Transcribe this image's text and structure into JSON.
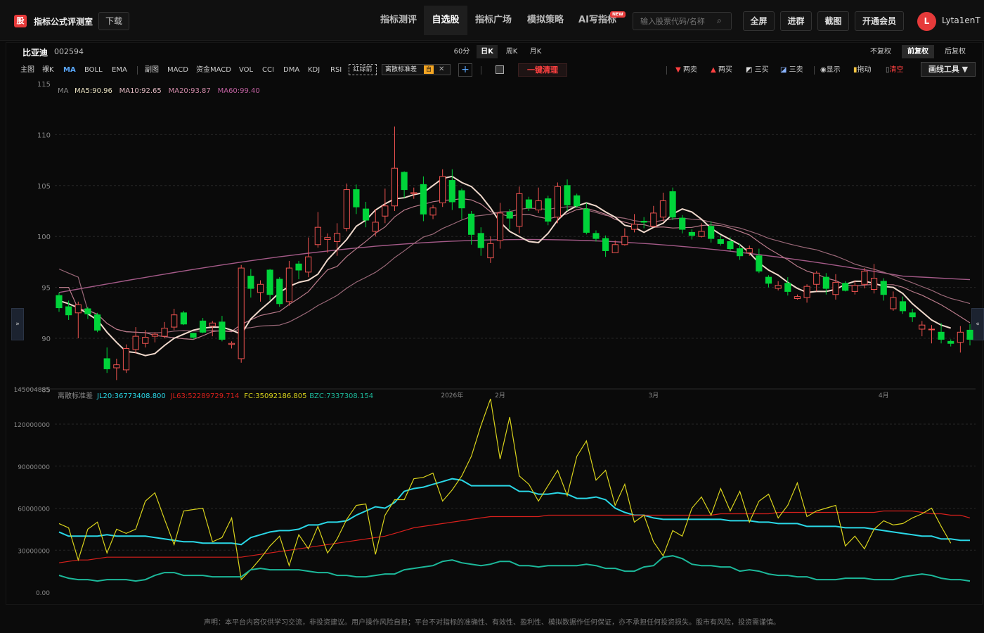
{
  "header": {
    "logo_char": "股",
    "app_name": "指标公式评测室",
    "download": "下载",
    "nav": [
      "指标测评",
      "自选股",
      "指标广场",
      "模拟策略",
      "AI写指标"
    ],
    "nav_active": 1,
    "new_badge": "NEW",
    "search_placeholder": "输入股票代码/名称",
    "buttons": [
      "全屏",
      "进群",
      "截图",
      "开通会员"
    ],
    "avatar_letter": "L",
    "username": "Lyta1enT"
  },
  "stock": {
    "name": "比亚迪",
    "code": "002594"
  },
  "periods": [
    "60分",
    "日K",
    "周K",
    "月K"
  ],
  "period_active": 1,
  "adjust": [
    "不复权",
    "前复权",
    "后复权"
  ],
  "adjust_active": 1,
  "indicator_bar": {
    "main": [
      "主图",
      "裸K",
      "MA",
      "BOLL",
      "EMA"
    ],
    "main_active": 2,
    "sub": [
      "副图",
      "MACD",
      "资金MACD",
      "VOL",
      "CCI",
      "DMA",
      "KDJ",
      "RSI"
    ],
    "highlight": "红绿箭",
    "chip": "离散标准差",
    "chip_tag": "自",
    "clear": "一键清理"
  },
  "tools": {
    "sell2": "两卖",
    "buy2": "两买",
    "buy3": "三买",
    "sell3": "三卖",
    "show": "显示",
    "drag": "拖动",
    "clear": "清空",
    "draw": "画线工具 ▼"
  },
  "colors": {
    "up": "#ef5350",
    "down": "#00d43a",
    "ma5": "#f0d9cc",
    "ma10": "#b87a8a",
    "ma20": "#9a6878",
    "ma60": "#a45a88",
    "jl20": "#2ad7e6",
    "jl63": "#d8201c",
    "fc": "#d8d21c",
    "bzc": "#1cb89a"
  },
  "chart_data": [
    {
      "type": "candlestick",
      "legend": {
        "name": "MA",
        "items": [
          {
            "label": "MA5:90.96",
            "color": "#e8e0c0"
          },
          {
            "label": "MA10:92.65",
            "color": "#e0b8c0"
          },
          {
            "label": "MA20:93.87",
            "color": "#d08aa8"
          },
          {
            "label": "MA60:99.40",
            "color": "#c060a0"
          }
        ]
      },
      "y_ticks": [
        "115",
        "110",
        "105",
        "100",
        "95",
        "90",
        "85"
      ],
      "ylim": [
        85,
        115
      ],
      "x_labels": [
        {
          "label": "2026年",
          "index": 41
        },
        {
          "label": "2月",
          "index": 46
        },
        {
          "label": "3月",
          "index": 62
        },
        {
          "label": "4月",
          "index": 86
        }
      ],
      "candles": [
        [
          94.2,
          93.0,
          94.5,
          92.6
        ],
        [
          93.1,
          92.3,
          93.7,
          91.8
        ],
        [
          92.5,
          93.3,
          93.6,
          90.0
        ],
        [
          92.9,
          92.4,
          93.1,
          91.9
        ],
        [
          92.3,
          90.8,
          92.5,
          90.6
        ],
        [
          88.0,
          87.0,
          89.1,
          86.6
        ],
        [
          87.1,
          87.4,
          88.0,
          85.9
        ],
        [
          86.9,
          89.0,
          89.4,
          86.6
        ],
        [
          88.9,
          90.2,
          91.1,
          88.5
        ],
        [
          89.5,
          90.1,
          90.8,
          89.1
        ],
        [
          90.2,
          90.4,
          90.6,
          89.6
        ],
        [
          90.2,
          91.0,
          91.6,
          90.0
        ],
        [
          91.1,
          92.3,
          92.9,
          90.8
        ],
        [
          92.5,
          91.4,
          92.7,
          91.3
        ],
        [
          90.5,
          90.1,
          90.5,
          89.9
        ],
        [
          91.7,
          90.6,
          92.0,
          90.5
        ],
        [
          91.2,
          91.5,
          91.7,
          90.2
        ],
        [
          91.6,
          89.9,
          92.2,
          89.7
        ],
        [
          89.4,
          89.5,
          89.7,
          89.0
        ],
        [
          88.0,
          96.9,
          97.2,
          87.6
        ],
        [
          96.1,
          94.9,
          96.8,
          94.0
        ],
        [
          94.5,
          95.3,
          95.7,
          93.6
        ],
        [
          96.7,
          94.3,
          96.8,
          93.7
        ],
        [
          95.8,
          93.4,
          96.0,
          93.1
        ],
        [
          93.6,
          96.9,
          97.6,
          93.2
        ],
        [
          97.3,
          96.7,
          97.6,
          95.8
        ],
        [
          96.5,
          98.0,
          99.9,
          96.0
        ],
        [
          99.2,
          100.9,
          102.4,
          98.9
        ],
        [
          99.7,
          99.9,
          100.3,
          98.4
        ],
        [
          99.5,
          100.3,
          101.3,
          98.1
        ],
        [
          100.8,
          104.6,
          105.2,
          100.5
        ],
        [
          104.6,
          102.9,
          105.1,
          102.2
        ],
        [
          102.7,
          101.6,
          103.4,
          100.9
        ],
        [
          100.5,
          101.4,
          102.7,
          100.0
        ],
        [
          102.0,
          103.0,
          104.7,
          101.3
        ],
        [
          103.0,
          106.7,
          110.8,
          102.5
        ],
        [
          106.3,
          104.6,
          106.4,
          103.8
        ],
        [
          104.2,
          104.3,
          104.8,
          103.7
        ],
        [
          105.1,
          102.2,
          105.9,
          101.5
        ],
        [
          102.1,
          102.8,
          103.1,
          101.7
        ],
        [
          103.3,
          105.9,
          106.6,
          102.9
        ],
        [
          105.5,
          103.4,
          106.6,
          102.6
        ],
        [
          104.5,
          102.8,
          104.7,
          101.7
        ],
        [
          102.2,
          100.2,
          102.5,
          99.2
        ],
        [
          100.3,
          98.9,
          100.9,
          98.1
        ],
        [
          97.9,
          99.3,
          100.0,
          97.4
        ],
        [
          99.6,
          102.3,
          103.3,
          98.8
        ],
        [
          102.4,
          101.8,
          102.7,
          100.7
        ],
        [
          101.0,
          104.2,
          104.9,
          100.3
        ],
        [
          103.6,
          102.8,
          103.9,
          102.5
        ],
        [
          102.6,
          103.5,
          104.8,
          102.3
        ],
        [
          103.7,
          101.5,
          104.0,
          101.1
        ],
        [
          101.9,
          104.9,
          105.3,
          101.3
        ],
        [
          105.0,
          103.1,
          105.6,
          102.5
        ],
        [
          104.0,
          103.0,
          104.2,
          102.8
        ],
        [
          102.7,
          100.4,
          103.3,
          100.2
        ],
        [
          100.3,
          99.8,
          100.6,
          99.5
        ],
        [
          99.8,
          98.6,
          100.1,
          98.0
        ],
        [
          98.4,
          99.2,
          99.6,
          98.8
        ],
        [
          99.2,
          100.0,
          100.8,
          99.1
        ],
        [
          100.7,
          101.2,
          102.2,
          100.4
        ],
        [
          101.5,
          101.4,
          101.9,
          100.8
        ],
        [
          101.0,
          102.3,
          103.0,
          100.9
        ],
        [
          101.9,
          103.5,
          104.3,
          101.5
        ],
        [
          104.4,
          101.9,
          104.8,
          101.6
        ],
        [
          101.8,
          100.7,
          102.1,
          100.3
        ],
        [
          100.4,
          100.1,
          100.7,
          99.7
        ],
        [
          100.0,
          100.5,
          101.3,
          99.9
        ],
        [
          101.0,
          99.8,
          101.5,
          99.4
        ],
        [
          99.7,
          99.3,
          100.1,
          99.1
        ],
        [
          99.5,
          98.8,
          99.9,
          98.6
        ],
        [
          98.8,
          98.1,
          99.3,
          97.7
        ],
        [
          98.4,
          98.8,
          99.1,
          98.1
        ],
        [
          98.1,
          96.6,
          98.8,
          96.4
        ],
        [
          96.0,
          95.4,
          96.2,
          95.0
        ],
        [
          94.9,
          95.2,
          95.6,
          94.7
        ],
        [
          95.4,
          94.6,
          96.0,
          94.2
        ],
        [
          93.9,
          94.1,
          94.3,
          93.8
        ],
        [
          94.0,
          95.1,
          95.3,
          93.5
        ],
        [
          95.3,
          96.4,
          96.6,
          94.6
        ],
        [
          96.0,
          94.9,
          96.4,
          94.3
        ],
        [
          94.3,
          95.5,
          96.3,
          93.8
        ],
        [
          95.4,
          94.7,
          95.6,
          94.6
        ],
        [
          94.6,
          95.2,
          95.7,
          94.3
        ],
        [
          95.3,
          96.6,
          96.9,
          94.9
        ],
        [
          94.8,
          95.9,
          97.3,
          94.4
        ],
        [
          95.6,
          94.3,
          95.9,
          93.7
        ],
        [
          92.9,
          94.0,
          94.6,
          92.7
        ],
        [
          93.6,
          92.7,
          94.1,
          92.4
        ],
        [
          92.5,
          92.1,
          92.9,
          91.6
        ],
        [
          90.9,
          91.3,
          91.7,
          90.2
        ],
        [
          90.9,
          90.9,
          91.3,
          89.5
        ],
        [
          90.6,
          89.9,
          91.5,
          89.5
        ],
        [
          89.7,
          89.5,
          89.9,
          89.2
        ],
        [
          89.6,
          90.6,
          91.2,
          88.6
        ],
        [
          90.8,
          89.9,
          91.4,
          89.3
        ]
      ],
      "ma5": [
        93.7,
        93.4,
        93.0,
        92.4,
        91.8,
        90.6,
        89.6,
        88.7,
        88.6,
        88.3,
        88.5,
        89.3,
        90.0,
        90.4,
        90.8,
        91.0,
        91.1,
        91.1,
        90.8,
        90.4,
        91.9,
        92.8,
        93.6,
        94.5,
        95.1,
        95.5,
        95.7,
        96.3,
        97.7,
        98.7,
        99.7,
        101.0,
        101.6,
        102.6,
        103.2,
        103.7,
        103.8,
        104.1,
        104.3,
        105.0,
        105.7,
        105.9,
        105.3,
        104.9,
        104.0,
        102.8,
        101.4,
        100.5,
        100.0,
        99.5,
        99.4,
        100.3,
        101.6,
        102.5,
        103.0,
        103.3,
        103.0,
        102.4,
        101.9,
        101.1,
        100.9,
        100.4,
        100.9,
        101.3,
        102.2,
        102.7,
        102.4,
        101.7,
        100.8,
        100.2,
        99.7,
        99.2,
        98.4,
        97.4,
        96.7,
        96.2,
        95.5,
        94.9,
        94.5,
        94.6,
        94.6,
        94.8,
        95.3,
        95.6,
        95.6,
        95.4,
        95.1,
        95.0,
        94.4,
        93.4,
        92.6,
        91.8,
        91.3,
        91.0
      ]
    },
    {
      "type": "line",
      "legend": {
        "name": "离散标准差",
        "items": [
          {
            "label": "JL20:36773408.800",
            "color": "#2ad7e6"
          },
          {
            "label": "JL63:52289729.714",
            "color": "#d8201c"
          },
          {
            "label": "FC:35092186.805",
            "color": "#d8d21c"
          },
          {
            "label": "BZC:7337308.154",
            "color": "#1cb89a"
          }
        ]
      },
      "y_ticks": [
        "145004885",
        "120000000",
        "90000000",
        "60000000",
        "30000000",
        "0.00"
      ],
      "ylim": [
        0,
        145004885
      ],
      "series": [
        {
          "name": "JL20",
          "values": [
            43,
            40,
            40,
            40,
            40,
            41,
            40,
            40,
            40,
            40,
            39,
            38,
            37,
            36,
            36,
            35,
            35,
            35,
            35,
            34,
            39,
            41,
            43,
            44,
            44,
            45,
            48,
            48,
            50,
            50,
            51,
            55,
            58,
            61,
            60,
            64,
            72,
            74,
            75,
            77,
            79,
            81,
            80,
            76,
            76,
            76,
            76,
            76,
            72,
            72,
            70,
            70,
            71,
            70,
            67,
            67,
            68,
            66,
            60,
            57,
            55,
            55,
            53,
            52,
            52,
            52,
            52,
            52,
            52,
            52,
            51,
            51,
            51,
            50,
            50,
            49,
            49,
            49,
            47,
            47,
            47,
            47,
            46,
            46,
            46,
            45,
            44,
            43,
            42,
            41,
            40,
            40,
            38,
            38,
            37,
            37
          ]
        },
        {
          "name": "JL63",
          "values": [
            21,
            22,
            23,
            23,
            24,
            25,
            25,
            25,
            25,
            25,
            25,
            25,
            25,
            25,
            25,
            25,
            25,
            25,
            25,
            25,
            26,
            27,
            28,
            29,
            30,
            31,
            32,
            33,
            34,
            35,
            36,
            37,
            38,
            39,
            40,
            42,
            44,
            46,
            47,
            48,
            49,
            50,
            51,
            52,
            53,
            54,
            54,
            54,
            54,
            54,
            54,
            55,
            55,
            55,
            55,
            55,
            55,
            55,
            55,
            55,
            55,
            55,
            55,
            55,
            55,
            55,
            55,
            55,
            55,
            56,
            56,
            56,
            56,
            56,
            56,
            57,
            57,
            57,
            57,
            57,
            57,
            57,
            57,
            57,
            57,
            57,
            58,
            58,
            58,
            58,
            57,
            56,
            56,
            55,
            55,
            53
          ]
        },
        {
          "name": "FC",
          "values": [
            49,
            46,
            23,
            45,
            50,
            28,
            45,
            42,
            45,
            65,
            71,
            52,
            34,
            58,
            59,
            60,
            36,
            39,
            53,
            9,
            16,
            24,
            33,
            40,
            19,
            41,
            31,
            47,
            28,
            38,
            52,
            62,
            63,
            27,
            55,
            66,
            66,
            81,
            82,
            85,
            65,
            73,
            83,
            97,
            119,
            138,
            95,
            125,
            83,
            77,
            65,
            76,
            87,
            69,
            97,
            108,
            80,
            87,
            62,
            77,
            50,
            55,
            36,
            26,
            44,
            40,
            60,
            68,
            55,
            74,
            58,
            72,
            50,
            65,
            70,
            53,
            62,
            78,
            54,
            58,
            60,
            62,
            33,
            40,
            31,
            45,
            51,
            48,
            49,
            53,
            56,
            60,
            47,
            35
          ]
        },
        {
          "name": "BZC",
          "values": [
            12,
            10,
            9,
            9,
            8,
            9,
            9,
            9,
            8,
            9,
            12,
            14,
            14,
            12,
            12,
            12,
            11,
            11,
            11,
            11,
            16,
            17,
            16,
            16,
            16,
            16,
            15,
            14,
            14,
            12,
            12,
            11,
            11,
            12,
            13,
            13,
            16,
            17,
            18,
            19,
            22,
            23,
            21,
            20,
            19,
            20,
            22,
            22,
            19,
            19,
            18,
            19,
            19,
            19,
            19,
            20,
            19,
            17,
            17,
            15,
            15,
            18,
            19,
            25,
            26,
            24,
            20,
            19,
            19,
            18,
            18,
            15,
            16,
            15,
            13,
            12,
            12,
            11,
            11,
            9,
            9,
            9,
            10,
            10,
            10,
            9,
            9,
            9,
            11,
            12,
            13,
            12,
            10,
            9,
            9,
            8
          ]
        }
      ]
    }
  ],
  "disclaimer": "声明：本平台内容仅供学习交流，非投资建议。用户操作风险自担；平台不对指标的准确性、有效性、盈利性、模拟数据作任何保证，亦不承担任何投资损失。股市有风险，投资需谨慎。"
}
